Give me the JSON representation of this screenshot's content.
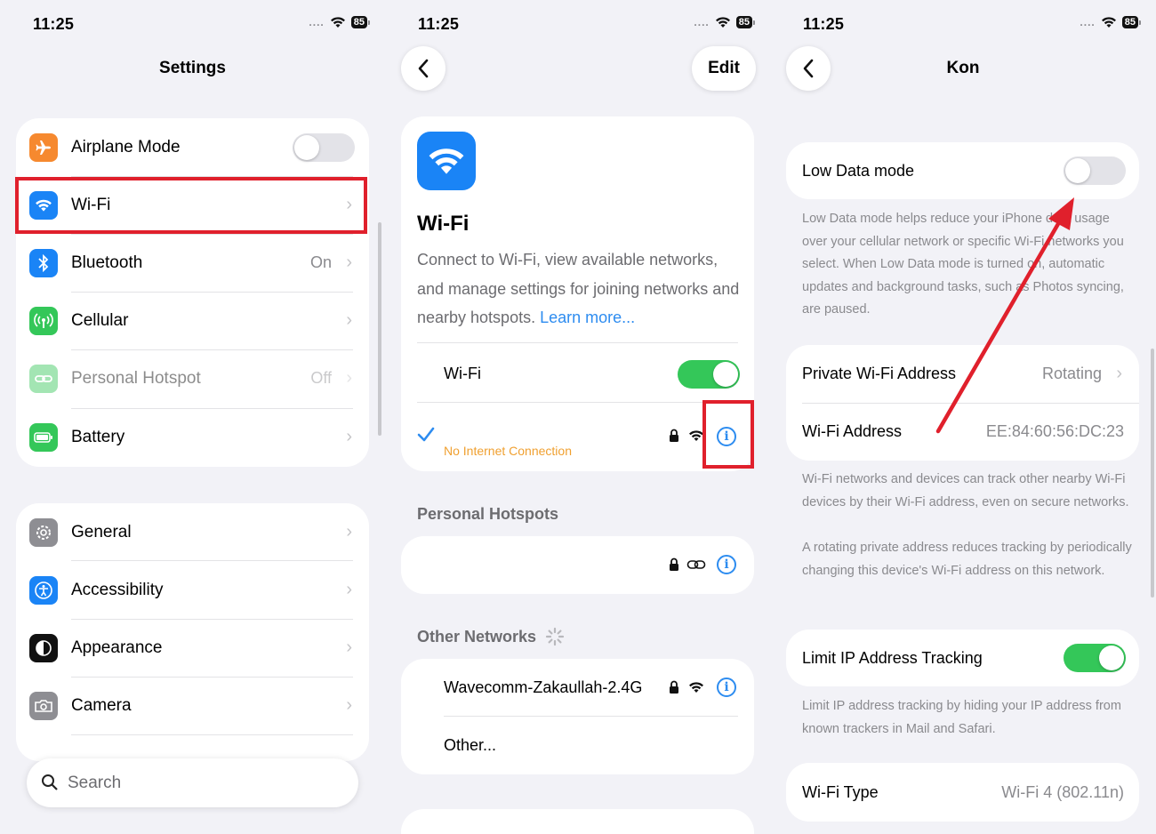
{
  "status": {
    "time": "11:25",
    "battery": "85"
  },
  "settings": {
    "title": "Settings",
    "group1": [
      {
        "label": "Airplane Mode",
        "value": "",
        "icon": "airplane-icon",
        "color": "#f6892f"
      },
      {
        "label": "Wi-Fi",
        "value": "",
        "icon": "wifi-icon",
        "color": "#1a84f6"
      },
      {
        "label": "Bluetooth",
        "value": "On",
        "icon": "bluetooth-icon",
        "color": "#1a84f6"
      },
      {
        "label": "Cellular",
        "value": "",
        "icon": "cellular-icon",
        "color": "#34c759"
      },
      {
        "label": "Personal Hotspot",
        "value": "Off",
        "icon": "hotspot-icon",
        "color": "#34c759"
      },
      {
        "label": "Battery",
        "value": "",
        "icon": "battery-icon",
        "color": "#34c759"
      }
    ],
    "group2": [
      {
        "label": "General",
        "icon": "gear-icon",
        "color": "#8e8e93"
      },
      {
        "label": "Accessibility",
        "icon": "accessibility-icon",
        "color": "#1a84f6"
      },
      {
        "label": "Appearance",
        "icon": "appearance-icon",
        "color": "#111111"
      },
      {
        "label": "Camera",
        "icon": "camera-icon",
        "color": "#8e8e93"
      }
    ],
    "search_placeholder": "Search"
  },
  "wifi": {
    "edit_label": "Edit",
    "title": "Wi-Fi",
    "description": "Connect to Wi-Fi, view available networks, and manage settings for joining networks and nearby hotspots.",
    "learn_more": "Learn more...",
    "toggle_label": "Wi-Fi",
    "connected_status": "No Internet Connection",
    "hotspots_header": "Personal Hotspots",
    "other_header": "Other Networks",
    "networks": [
      {
        "name": "Wavecomm-Zakaullah-2.4G"
      },
      {
        "name": "Other..."
      }
    ]
  },
  "network": {
    "title": "Kon",
    "low_data_label": "Low Data mode",
    "low_data_note": "Low Data mode helps reduce your iPhone data usage over your cellular network or specific Wi-Fi networks you select. When Low Data mode is turned on, automatic updates and background tasks, such as Photos syncing, are paused.",
    "private_address_label": "Private Wi-Fi Address",
    "private_address_value": "Rotating",
    "address_label": "Wi-Fi Address",
    "address_value": "EE:84:60:56:DC:23",
    "address_note_1": "Wi-Fi networks and devices can track other nearby Wi-Fi devices by their Wi-Fi address, even on secure networks.",
    "address_note_2": "A rotating private address reduces tracking by periodically changing this device's Wi-Fi address on this network.",
    "limit_ip_label": "Limit IP Address Tracking",
    "limit_ip_note": "Limit IP address tracking by hiding your IP address from known trackers in Mail and Safari.",
    "wifi_type_label": "Wi-Fi Type",
    "wifi_type_value": "Wi-Fi 4 (802.11n)"
  },
  "colors": {
    "accent": "#2d8cf0",
    "highlight": "#e0202c",
    "toggle_on": "#34c759",
    "warning": "#f0a030"
  }
}
